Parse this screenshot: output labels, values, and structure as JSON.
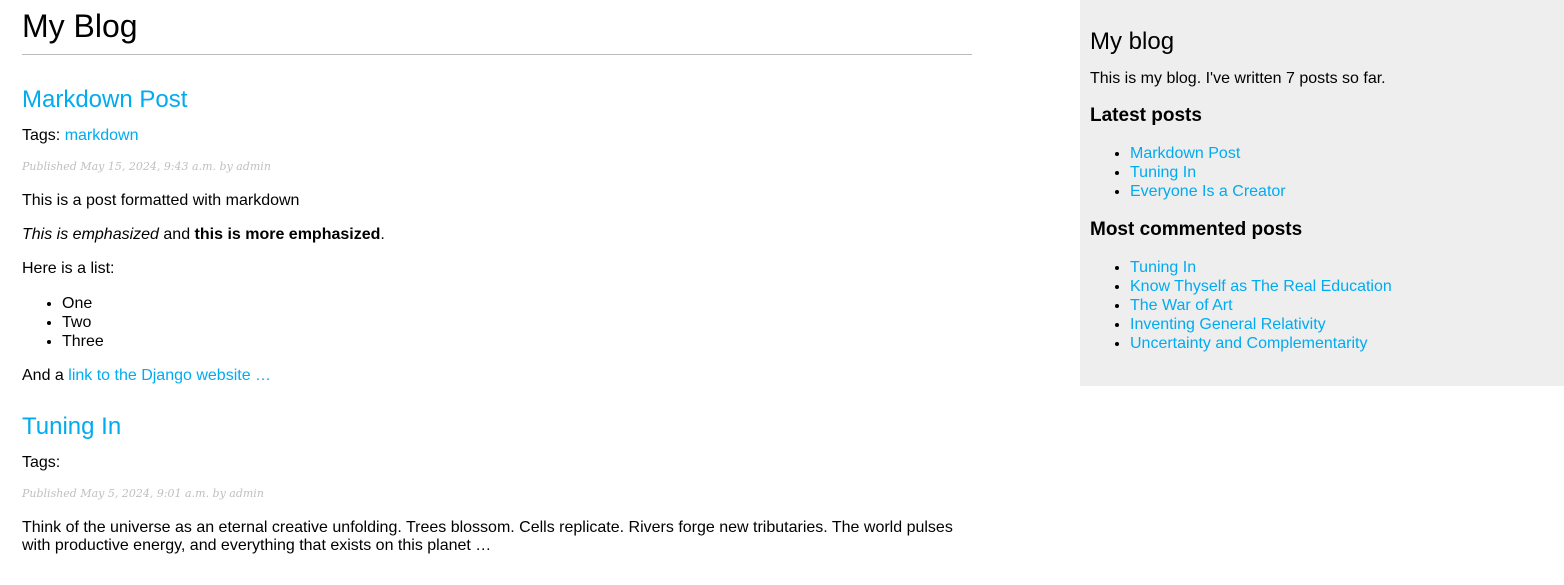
{
  "header": {
    "title": "My Blog"
  },
  "posts": [
    {
      "title": "Markdown Post",
      "tags_label": "Tags:",
      "tags": [
        "markdown"
      ],
      "meta": "Published May 15, 2024, 9:43 a.m. by admin",
      "paragraph1": "This is a post formatted with markdown",
      "emphasized": "This is emphasized",
      "and_text": " and ",
      "strong": "this is more emphasized",
      "period": ".",
      "list_intro": "Here is a list:",
      "list_items": [
        "One",
        "Two",
        "Three"
      ],
      "link_prefix": "And a ",
      "link_text": "link to the Django website …"
    },
    {
      "title": "Tuning In",
      "tags_label": "Tags:",
      "meta": "Published May 5, 2024, 9:01 a.m. by admin",
      "excerpt": "Think of the universe as an eternal creative unfolding. Trees blossom. Cells replicate. Rivers forge new tributaries. The world pulses with productive energy, and everything that exists on this planet …"
    }
  ],
  "sidebar": {
    "title": "My blog",
    "intro": "This is my blog. I've written 7 posts so far.",
    "latest_heading": "Latest posts",
    "latest_posts": [
      "Markdown Post",
      "Tuning In",
      "Everyone Is a Creator"
    ],
    "commented_heading": "Most commented posts",
    "commented_posts": [
      "Tuning In",
      "Know Thyself as The Real Education",
      "The War of Art",
      "Inventing General Relativity",
      "Uncertainty and Complementarity"
    ]
  },
  "colors": {
    "link": "#00abf0",
    "sidebar_bg": "#eeeeee",
    "meta": "#c0c0c0",
    "rule": "#bbbbbb"
  }
}
